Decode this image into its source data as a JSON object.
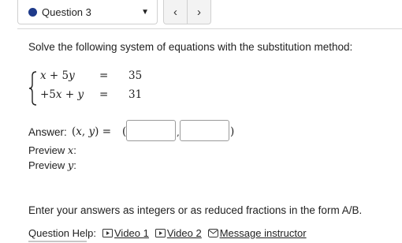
{
  "header": {
    "question_label": "Question 3",
    "prev_symbol": "‹",
    "next_symbol": "›",
    "accent_color": "#1e3a8a"
  },
  "prompt": "Solve the following system of equations with the substitution method:",
  "system": {
    "eq1": {
      "lhs": "x + 5y",
      "rel": "=",
      "rhs": "35"
    },
    "eq2": {
      "lhs": "+5x + y",
      "rel": "=",
      "rhs": "31"
    }
  },
  "answer": {
    "label": "Answer:",
    "expression": "(x, y) =",
    "x_value": "",
    "y_value": ""
  },
  "preview": {
    "x_label": "Preview x:",
    "y_label": "Preview y:"
  },
  "instructions": "Enter your answers as integers or as reduced fractions in the form A/B.",
  "help": {
    "label": "Question Help:",
    "video1": "Video 1",
    "video2": "Video 2",
    "message": "Message instructor",
    "video_icon": "play-icon",
    "message_icon": "mail-icon"
  }
}
